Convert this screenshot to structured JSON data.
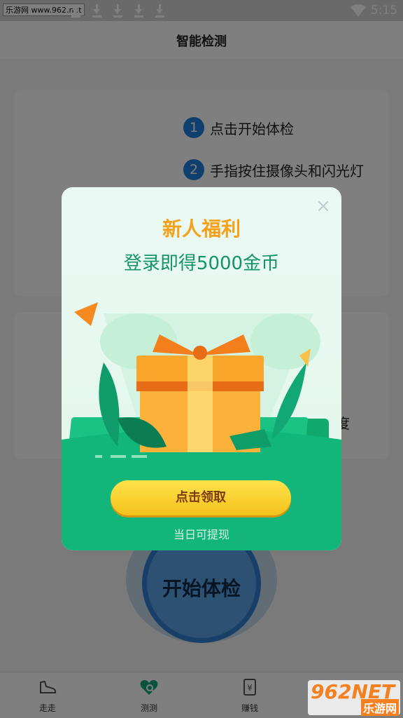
{
  "status_bar": {
    "watermark": "乐游网 www.962.net",
    "time": "5:15"
  },
  "header": {
    "title": "智能检测"
  },
  "steps": [
    {
      "num": "1",
      "text": "点击开始体检"
    },
    {
      "num": "2",
      "text": "手指按住摄像头和闪光灯"
    }
  ],
  "partial_text": "度",
  "start_button": {
    "label": "开始体检"
  },
  "bottom_nav": [
    {
      "label": "走走",
      "icon": "shoe-icon"
    },
    {
      "label": "测测",
      "icon": "heart-search-icon"
    },
    {
      "label": "赚钱",
      "icon": "yen-notebook-icon"
    }
  ],
  "dialog": {
    "title": "新人福利",
    "subtitle": "登录即得5000金币",
    "claim_button": "点击领取",
    "note": "当日可提现"
  },
  "watermark_br": {
    "big": "962NET",
    "small": "乐游网"
  },
  "colors": {
    "dialog_green": "#12b57a",
    "title_orange": "#f7a11a",
    "subtitle_green": "#15936a",
    "step_blue": "#1f7fd9",
    "claim_yellow": "#f4c21b"
  }
}
